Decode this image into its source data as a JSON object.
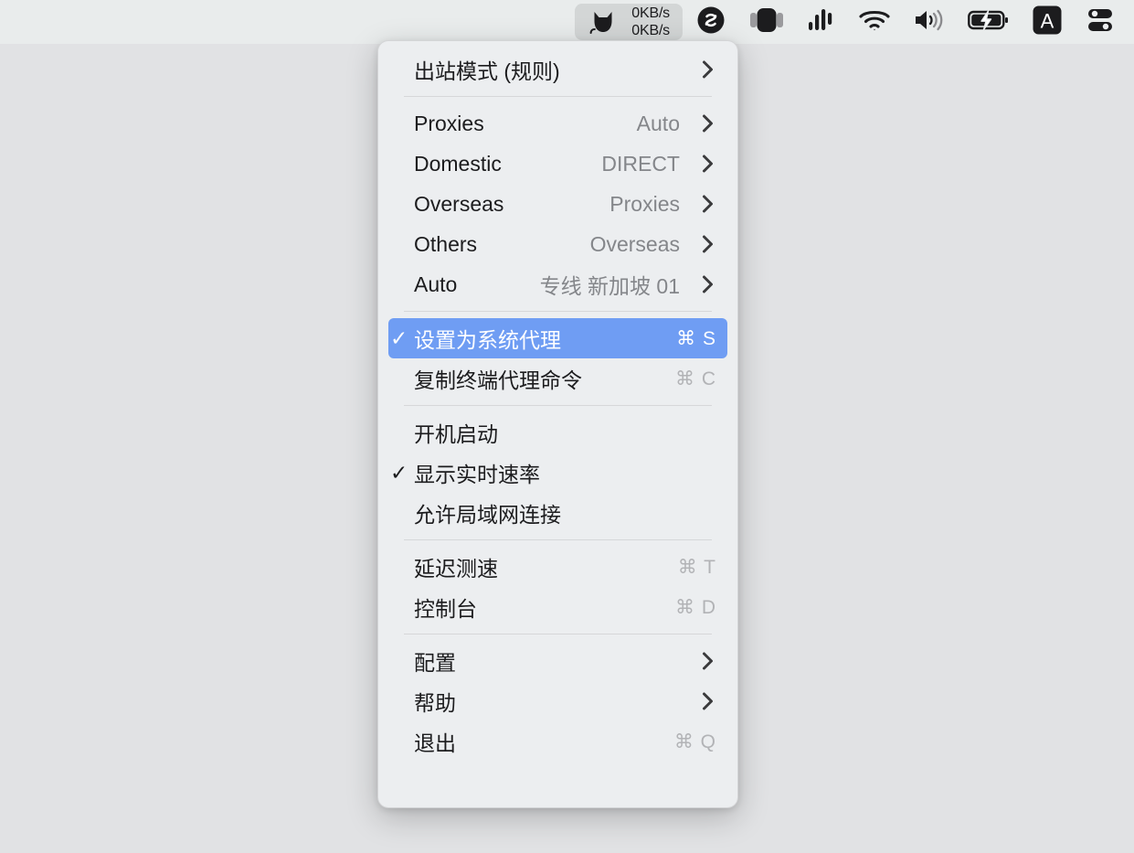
{
  "menubar": {
    "clash": {
      "icon": "cat-icon",
      "upload_speed": "0KB/s",
      "download_speed": "0KB/s",
      "active": true
    },
    "items": [
      {
        "name": "shazam-icon",
        "label": "Shazam"
      },
      {
        "name": "screen-record-icon",
        "label": "Screen Recording"
      },
      {
        "name": "audio-levels-icon",
        "label": "Audio Levels"
      },
      {
        "name": "wifi-icon",
        "label": "Wi-Fi"
      },
      {
        "name": "volume-icon",
        "label": "Volume"
      },
      {
        "name": "battery-charging-icon",
        "label": "Battery Charging"
      },
      {
        "name": "input-source-icon",
        "label": "A"
      },
      {
        "name": "control-center-icon",
        "label": "Control Center"
      }
    ]
  },
  "menu": {
    "mode_row": {
      "label": "出站模式 (规则)",
      "value": "",
      "chevron": "chevron-right-icon"
    },
    "proxy_groups": [
      {
        "label": "Proxies",
        "value": "Auto",
        "chevron": "chevron-right-icon"
      },
      {
        "label": "Domestic",
        "value": "DIRECT",
        "chevron": "chevron-right-icon"
      },
      {
        "label": "Overseas",
        "value": "Proxies",
        "chevron": "chevron-right-icon"
      },
      {
        "label": "Others",
        "value": "Overseas",
        "chevron": "chevron-right-icon"
      },
      {
        "label": "Auto",
        "value": "专线 新加坡 01",
        "chevron": "chevron-right-icon"
      }
    ],
    "system_proxy": {
      "label": "设置为系统代理",
      "shortcut": "⌘ S",
      "checked": true,
      "highlighted": true
    },
    "copy_command": {
      "label": "复制终端代理命令",
      "shortcut": "⌘ C",
      "checked": false
    },
    "options": [
      {
        "label": "开机启动",
        "checked": false
      },
      {
        "label": "显示实时速率",
        "checked": true
      },
      {
        "label": "允许局域网连接",
        "checked": false
      }
    ],
    "tools": [
      {
        "label": "延迟测速",
        "shortcut": "⌘ T"
      },
      {
        "label": "控制台",
        "shortcut": "⌘ D"
      }
    ],
    "footer": [
      {
        "label": "配置",
        "shortcut": "",
        "chevron": "chevron-right-icon"
      },
      {
        "label": "帮助",
        "shortcut": "",
        "chevron": "chevron-right-icon"
      },
      {
        "label": "退出",
        "shortcut": "⌘ Q",
        "chevron": ""
      }
    ],
    "checkmark_glyph": "✓"
  },
  "colors": {
    "highlight_blue": "#6f9df3",
    "menu_bg": "#eceef0",
    "menubar_bg": "#e9ecec",
    "desktop_bg": "#e1e2e4",
    "label_text": "#1c1c1e",
    "value_text": "#84868a",
    "shortcut_text": "#b2b3b6"
  }
}
